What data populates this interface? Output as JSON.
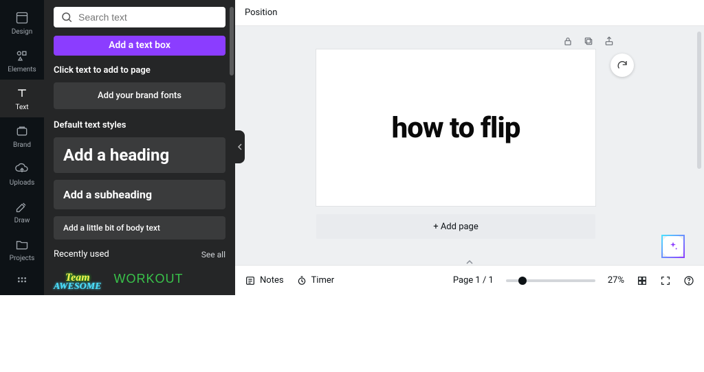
{
  "rail": {
    "items": [
      {
        "label": "Design"
      },
      {
        "label": "Elements"
      },
      {
        "label": "Text"
      },
      {
        "label": "Brand"
      },
      {
        "label": "Uploads"
      },
      {
        "label": "Draw"
      },
      {
        "label": "Projects"
      }
    ],
    "active_index": 2
  },
  "panel": {
    "search_placeholder": "Search text",
    "add_text_box": "Add a text box",
    "click_hint": "Click text to add to page",
    "add_brand_fonts": "Add your brand fonts",
    "default_styles_label": "Default text styles",
    "heading": "Add a heading",
    "subheading": "Add a subheading",
    "body": "Add a little bit of body text",
    "recently_used": "Recently used",
    "see_all": "See all",
    "recent_items": [
      {
        "line1": "Team",
        "line2": "AWESOME"
      },
      {
        "line1": "WORKOUT"
      }
    ]
  },
  "topbar": {
    "position": "Position"
  },
  "canvas": {
    "page_text": "how to flip",
    "add_page": "+ Add page"
  },
  "bottom": {
    "notes": "Notes",
    "timer": "Timer",
    "page_indicator": "Page 1 / 1",
    "zoom": "27%"
  }
}
